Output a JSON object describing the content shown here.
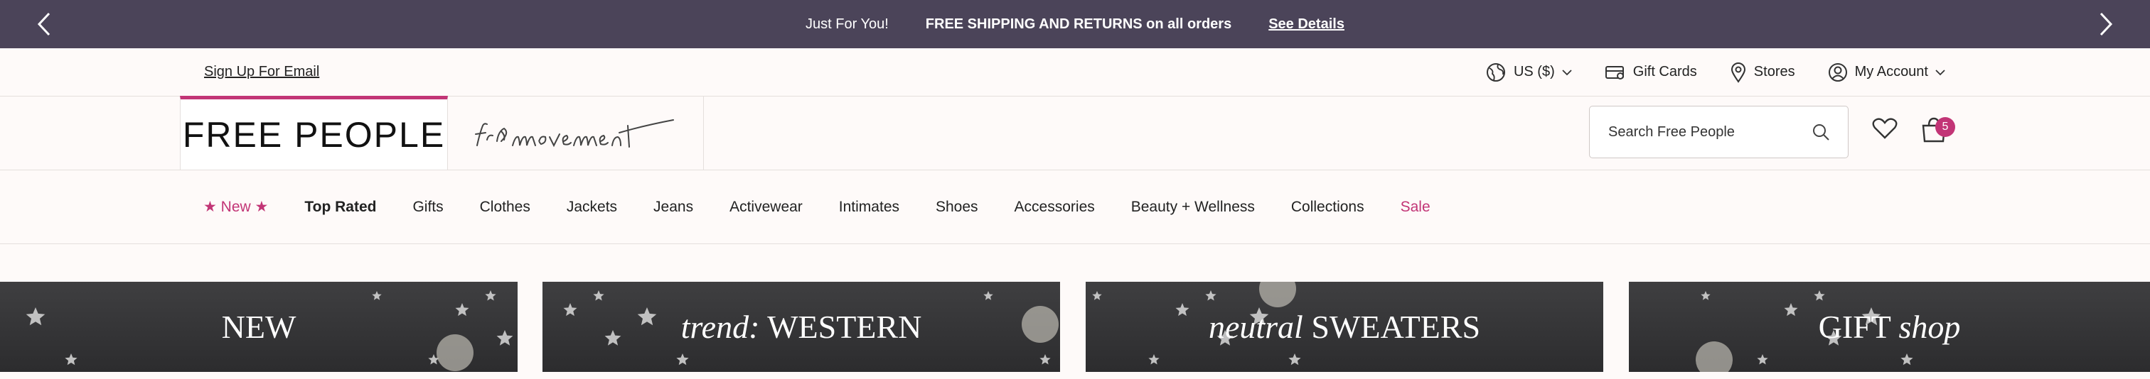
{
  "promo": {
    "text1": "Just For You!",
    "text2": "FREE SHIPPING AND RETURNS on all orders",
    "link": "See Details"
  },
  "utility": {
    "signup": "Sign Up For Email",
    "currency": "US ($)",
    "gift_cards": "Gift Cards",
    "stores": "Stores",
    "account": "My Account"
  },
  "header": {
    "brand_primary": "FREE PEOPLE",
    "brand_secondary": "fp movement",
    "search_placeholder": "Search Free People",
    "bag_count": "5"
  },
  "nav": {
    "items": [
      {
        "label": "New",
        "style": "new"
      },
      {
        "label": "Top Rated",
        "style": "bold"
      },
      {
        "label": "Gifts"
      },
      {
        "label": "Clothes"
      },
      {
        "label": "Jackets"
      },
      {
        "label": "Jeans"
      },
      {
        "label": "Activewear"
      },
      {
        "label": "Intimates"
      },
      {
        "label": "Shoes"
      },
      {
        "label": "Accessories"
      },
      {
        "label": "Beauty + Wellness"
      },
      {
        "label": "Collections"
      },
      {
        "label": "Sale",
        "style": "accent"
      }
    ]
  },
  "tiles": [
    {
      "italic": "",
      "text": "NEW"
    },
    {
      "italic": "trend:",
      "text": "WESTERN"
    },
    {
      "italic": "neutral",
      "text": "SWEATERS"
    },
    {
      "italic": "",
      "text": "GIFT",
      "italic_after": "shop"
    }
  ],
  "colors": {
    "promo_bg": "#4b4459",
    "accent": "#c23576",
    "page_bg": "#fefaf9",
    "tile_bg": "#2c2c2e"
  }
}
